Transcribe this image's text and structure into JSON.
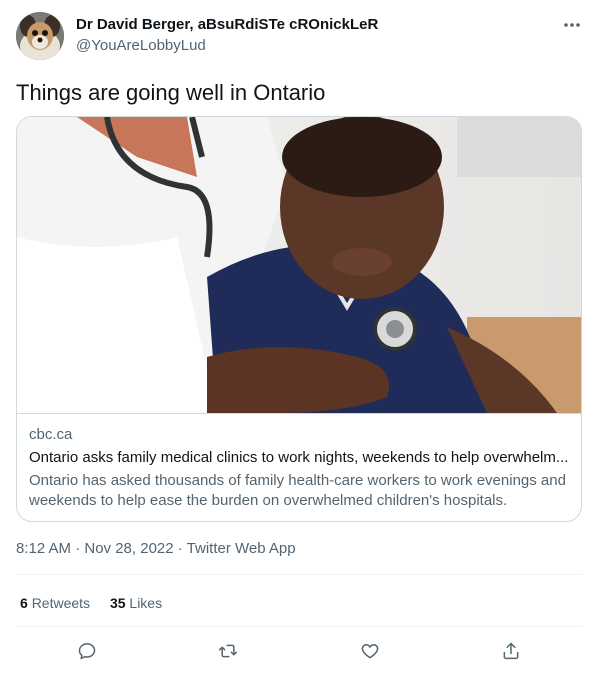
{
  "author": {
    "name": "Dr David Berger, aBsuRdiSTe cROnickLeR",
    "handle": "@YouAreLobbyLud",
    "avatar_icon": "dog-avatar"
  },
  "tweet": {
    "text": "Things are going well in Ontario",
    "timestamp": "8:12 AM · Nov 28, 2022 · ",
    "source": "Twitter Web App"
  },
  "card": {
    "domain": "cbc.ca",
    "title": "Ontario asks family medical clinics to work nights, weekends to help overwhelm...",
    "description": "Ontario has asked thousands of family health-care workers to work evenings and weekends to help ease the burden on overwhelmed children's hospitals.",
    "image_icon": "doctor-examining-child-photo"
  },
  "stats": {
    "retweets_count": "6",
    "retweets_label": "Retweets",
    "likes_count": "35",
    "likes_label": "Likes"
  },
  "actions": [
    "reply-icon",
    "retweet-icon",
    "like-icon",
    "share-icon"
  ],
  "colors": {
    "text": "#0f1419",
    "secondary": "#536471",
    "border": "#cfd9de",
    "divider": "#eff3f4"
  }
}
